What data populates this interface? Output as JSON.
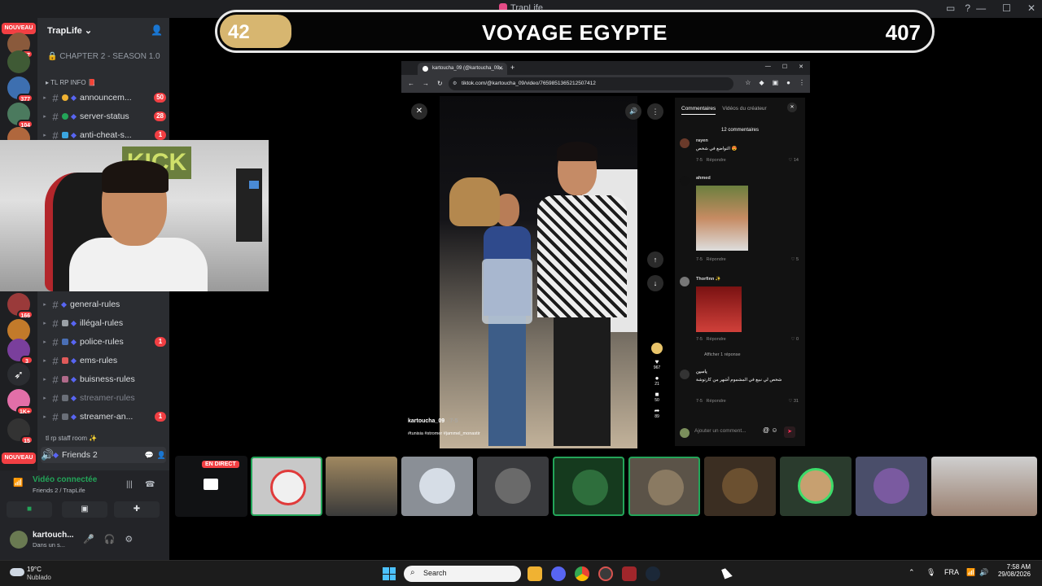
{
  "window": {
    "title": "TrapLife"
  },
  "server": {
    "name": "TrapLife",
    "locked_channel": "CHAPTER 2 - SEASON 1.0",
    "categories": [
      "TL RP INFO 📕",
      "tl rp staff room ✨"
    ],
    "channels_top": [
      {
        "name": "announcem...",
        "count": "50"
      },
      {
        "name": "server-status",
        "count": "28"
      },
      {
        "name": "anti-cheat-s...",
        "count": "1"
      }
    ],
    "channels_bottom": [
      {
        "name": "general-rules",
        "count": ""
      },
      {
        "name": "illégal-rules",
        "count": ""
      },
      {
        "name": "police-rules",
        "count": "1"
      },
      {
        "name": "ems-rules",
        "count": ""
      },
      {
        "name": "buisness-rules",
        "count": ""
      },
      {
        "name": "streamer-rules",
        "count": ""
      },
      {
        "name": "streamer-an...",
        "count": "1"
      }
    ],
    "voice_channel": "Friends 2"
  },
  "rail": {
    "badges": [
      "17",
      "377",
      "104",
      "166",
      "3",
      "1K+",
      "15"
    ],
    "nouveau_label": "NOUVEAU"
  },
  "overlay": {
    "left_value": "42",
    "title": "VOYAGE EGYPTE",
    "right_value": "407"
  },
  "browser": {
    "tab_title": "kartoucha_09 (@kartoucha_09...",
    "url": "tiktok.com/@kartoucha_09/video/7659851365212507412"
  },
  "tiktok": {
    "author": "kartoucha_09",
    "time": "· 7-5",
    "tags": "#tunisia #stromer #jammel_monastir",
    "tabs": [
      "Commentaires",
      "Vidéos du créateur"
    ],
    "comments_count": "12 commentaires",
    "comments": [
      {
        "user": "rayen",
        "text": "التواضع في شخص 😍",
        "date": "7-5",
        "reply": "Répondre",
        "likes": "14"
      },
      {
        "user": "ahmed",
        "text": "",
        "date": "7-5",
        "reply": "Répondre",
        "likes": "5"
      },
      {
        "user": "Thorfinn ✨",
        "text": "",
        "date": "7-5",
        "reply": "Répondre",
        "likes": "0"
      },
      {
        "user": "ياسين",
        "text": "شخص لي نبيع في المشموم أشهر من كارتوشة",
        "date": "7-5",
        "reply": "Répondre",
        "likes": "31"
      }
    ],
    "show_replies": "Afficher 1 réponse",
    "action_counts": [
      "967",
      "21",
      "50",
      "89"
    ],
    "comment_placeholder": "Ajouter un comment..."
  },
  "live": {
    "badge": "EN DIRECT"
  },
  "voice_panel": {
    "status": "Vidéo connectée",
    "channel": "Friends 2 / TrapLife"
  },
  "user_panel": {
    "name": "kartouch...",
    "status": "Dans un s..."
  },
  "taskbar": {
    "temperature": "19°C",
    "condition": "Nublado",
    "search_placeholder": "Search",
    "language": "FRA",
    "time": "7:58 AM",
    "date": "29/08/2026"
  },
  "colors": {
    "discord_dark": "#1e1f22",
    "discord_sidebar": "#2b2d31",
    "accent_red": "#f23f43",
    "speaking_green": "#23a559",
    "overlay_gold": "#d7b670"
  }
}
